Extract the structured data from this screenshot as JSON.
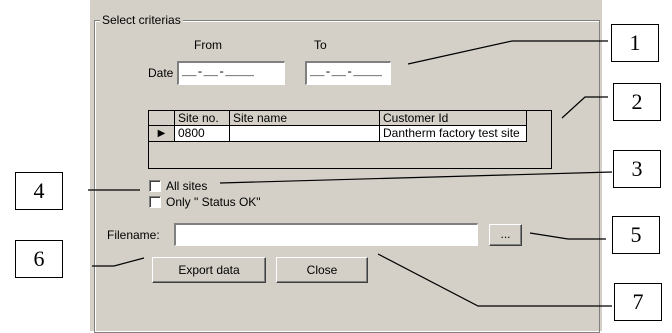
{
  "dialog": {
    "group_title": "Select criterias",
    "from_label": "From",
    "to_label": "To",
    "date_label": "Date",
    "date_from_value": "__-__-____",
    "date_to_value": "__-__-____",
    "grid": {
      "headers": [
        "Site no.",
        "Site name",
        "Customer Id"
      ],
      "rows": [
        {
          "marker": "▶",
          "site_no": "0800",
          "site_name": "",
          "customer_id": "Dantherm factory test site"
        }
      ]
    },
    "all_sites_label": "All sites",
    "only_status_ok_label": "Only \" Status OK\"",
    "filename_label": "Filename:",
    "filename_value": "",
    "browse_label": "...",
    "export_label": "Export data",
    "close_label": "Close"
  },
  "callouts": [
    "1",
    "2",
    "3",
    "4",
    "5",
    "6",
    "7"
  ]
}
